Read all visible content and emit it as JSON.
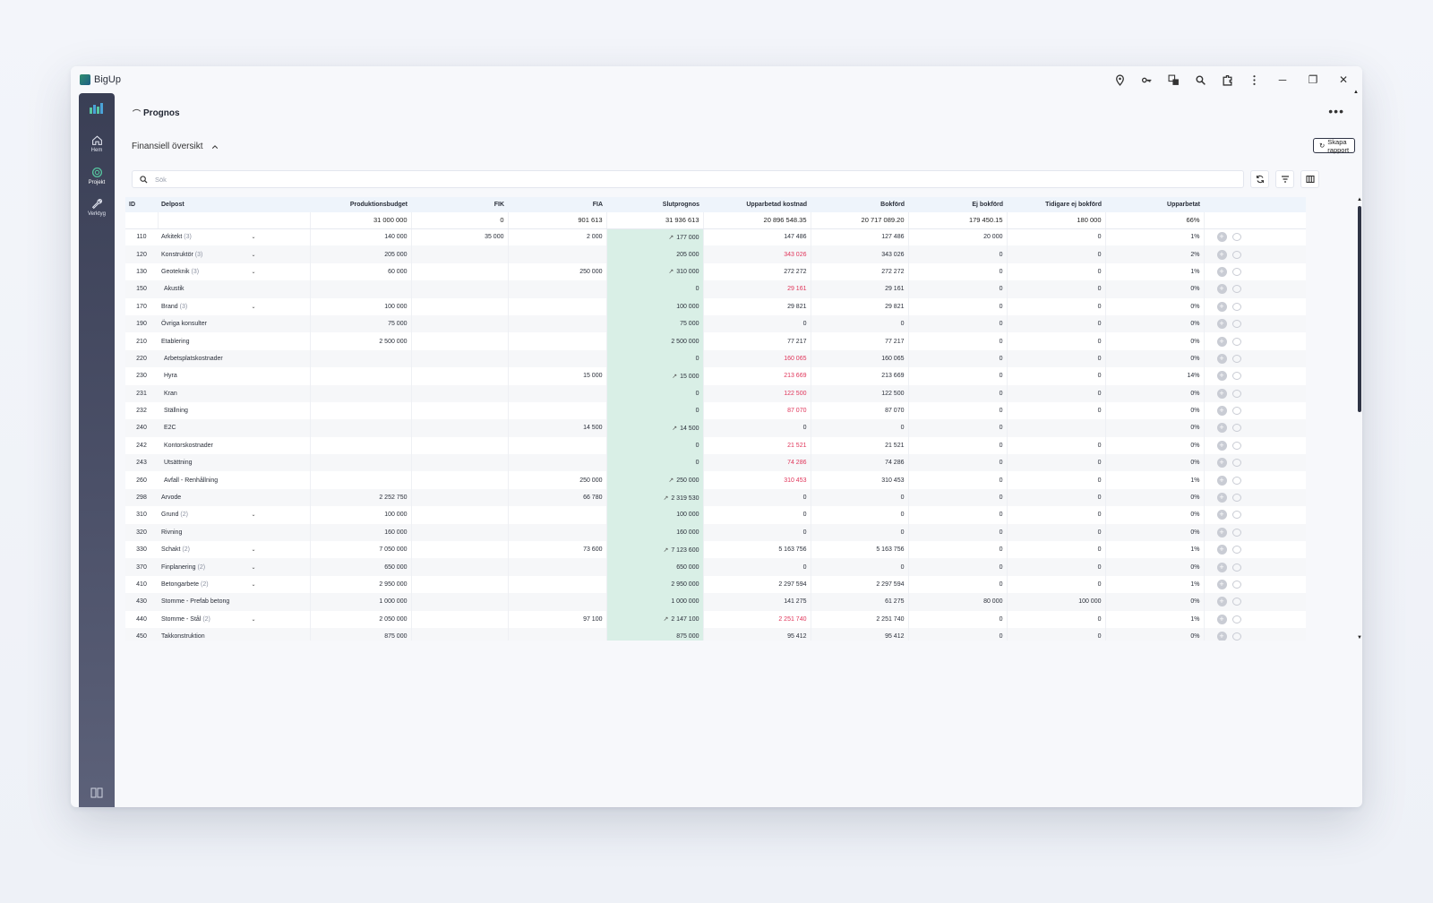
{
  "app": {
    "title": "BigUp"
  },
  "titlebar_icons": [
    "location-pin-icon",
    "key-icon",
    "translate-icon",
    "zoom-icon",
    "extension-icon",
    "kebab-menu-icon"
  ],
  "window_controls": {
    "minimize": "─",
    "restore": "❐",
    "close": "✕"
  },
  "sidebar": {
    "items": [
      {
        "label": "Hem",
        "icon": "home-icon"
      },
      {
        "label": "Projekt",
        "icon": "project-icon",
        "active": true
      },
      {
        "label": "Verktyg",
        "icon": "wrench-icon"
      }
    ]
  },
  "header": {
    "breadcrumb": "Prognos",
    "more": "•••"
  },
  "section": {
    "title": "Finansiell översikt",
    "report_button": "Skapa rapport"
  },
  "search": {
    "placeholder": "Sök"
  },
  "table": {
    "columns": [
      "ID",
      "Delpost",
      "Produktionsbudget",
      "FIK",
      "FIA",
      "Slutprognos",
      "Upparbetad kostnad",
      "Bokförd",
      "Ej bokförd",
      "Tidigare ej bokförd",
      "Upparbetat"
    ],
    "summary": [
      "",
      "",
      "31 000 000",
      "0",
      "901 613",
      "31 936 613",
      "20 896 548.35",
      "20 717 089.20",
      "179 450.15",
      "180 000",
      "66%"
    ],
    "rows": [
      {
        "id": "110",
        "name": "Arkitekt",
        "sub": "(3)",
        "exp": true,
        "pb": "140 000",
        "fik": "35 000",
        "fia": "2 000",
        "slut": "177 000",
        "trend": true,
        "upp": "147 486",
        "neg": false,
        "bok": "127 486",
        "ej": "20 000",
        "tid": "0",
        "pct": "1%"
      },
      {
        "id": "120",
        "name": "Konstruktör",
        "sub": "(3)",
        "exp": true,
        "pb": "205 000",
        "fik": "",
        "fia": "",
        "slut": "205 000",
        "trend": false,
        "upp": "343 026",
        "neg": true,
        "bok": "343 026",
        "ej": "0",
        "tid": "0",
        "pct": "2%"
      },
      {
        "id": "130",
        "name": "Geoteknik",
        "sub": "(3)",
        "exp": true,
        "pb": "60 000",
        "fik": "",
        "fia": "250 000",
        "slut": "310 000",
        "trend": true,
        "upp": "272 272",
        "neg": false,
        "bok": "272 272",
        "ej": "0",
        "tid": "0",
        "pct": "1%"
      },
      {
        "id": "150",
        "name": "Akustik",
        "sub": "",
        "exp": false,
        "ind": true,
        "pb": "",
        "fik": "",
        "fia": "",
        "slut": "0",
        "trend": false,
        "upp": "29 161",
        "neg": true,
        "bok": "29 161",
        "ej": "0",
        "tid": "0",
        "pct": "0%"
      },
      {
        "id": "170",
        "name": "Brand",
        "sub": "(3)",
        "exp": true,
        "pb": "100 000",
        "fik": "",
        "fia": "",
        "slut": "100 000",
        "trend": false,
        "upp": "29 821",
        "neg": false,
        "bok": "29 821",
        "ej": "0",
        "tid": "0",
        "pct": "0%"
      },
      {
        "id": "190",
        "name": "Övriga konsulter",
        "sub": "",
        "exp": false,
        "pb": "75 000",
        "fik": "",
        "fia": "",
        "slut": "75 000",
        "trend": false,
        "upp": "0",
        "neg": false,
        "bok": "0",
        "ej": "0",
        "tid": "0",
        "pct": "0%"
      },
      {
        "id": "210",
        "name": "Etablering",
        "sub": "",
        "exp": false,
        "pb": "2 500 000",
        "fik": "",
        "fia": "",
        "slut": "2 500 000",
        "trend": false,
        "upp": "77 217",
        "neg": false,
        "bok": "77 217",
        "ej": "0",
        "tid": "0",
        "pct": "0%"
      },
      {
        "id": "220",
        "name": "Arbetsplatskostnader",
        "sub": "",
        "exp": false,
        "ind": true,
        "pb": "",
        "fik": "",
        "fia": "",
        "slut": "0",
        "trend": false,
        "upp": "160 065",
        "neg": true,
        "bok": "160 065",
        "ej": "0",
        "tid": "0",
        "pct": "0%"
      },
      {
        "id": "230",
        "name": "Hyra",
        "sub": "",
        "exp": false,
        "ind": true,
        "pb": "",
        "fik": "",
        "fia": "15 000",
        "slut": "15 000",
        "trend": true,
        "upp": "213 669",
        "neg": true,
        "bok": "213 669",
        "ej": "0",
        "tid": "0",
        "pct": "14%"
      },
      {
        "id": "231",
        "name": "Kran",
        "sub": "",
        "exp": false,
        "ind": true,
        "pb": "",
        "fik": "",
        "fia": "",
        "slut": "0",
        "trend": false,
        "upp": "122 500",
        "neg": true,
        "bok": "122 500",
        "ej": "0",
        "tid": "0",
        "pct": "0%"
      },
      {
        "id": "232",
        "name": "Ställning",
        "sub": "",
        "exp": false,
        "ind": true,
        "pb": "",
        "fik": "",
        "fia": "",
        "slut": "0",
        "trend": false,
        "upp": "87 070",
        "neg": true,
        "bok": "87 070",
        "ej": "0",
        "tid": "0",
        "pct": "0%"
      },
      {
        "id": "240",
        "name": "E2C",
        "sub": "",
        "exp": false,
        "ind": true,
        "pb": "",
        "fik": "",
        "fia": "14 500",
        "slut": "14 500",
        "trend": true,
        "upp": "0",
        "neg": false,
        "bok": "0",
        "ej": "0",
        "tid": "",
        "pct": "0%"
      },
      {
        "id": "242",
        "name": "Kontorskostnader",
        "sub": "",
        "exp": false,
        "ind": true,
        "pb": "",
        "fik": "",
        "fia": "",
        "slut": "0",
        "trend": false,
        "upp": "21 521",
        "neg": true,
        "bok": "21 521",
        "ej": "0",
        "tid": "0",
        "pct": "0%"
      },
      {
        "id": "243",
        "name": "Utsättning",
        "sub": "",
        "exp": false,
        "ind": true,
        "pb": "",
        "fik": "",
        "fia": "",
        "slut": "0",
        "trend": false,
        "upp": "74 286",
        "neg": true,
        "bok": "74 286",
        "ej": "0",
        "tid": "0",
        "pct": "0%"
      },
      {
        "id": "260",
        "name": "Avfall - Renhållning",
        "sub": "",
        "exp": false,
        "ind": true,
        "pb": "",
        "fik": "",
        "fia": "250 000",
        "slut": "250 000",
        "trend": true,
        "upp": "310 453",
        "neg": true,
        "bok": "310 453",
        "ej": "0",
        "tid": "0",
        "pct": "1%"
      },
      {
        "id": "298",
        "name": "Arvode",
        "sub": "",
        "exp": false,
        "pb": "2 252 750",
        "fik": "",
        "fia": "66 780",
        "slut": "2 319 530",
        "trend": true,
        "upp": "0",
        "neg": false,
        "bok": "0",
        "ej": "0",
        "tid": "0",
        "pct": "0%"
      },
      {
        "id": "310",
        "name": "Grund",
        "sub": "(2)",
        "exp": true,
        "pb": "100 000",
        "fik": "",
        "fia": "",
        "slut": "100 000",
        "trend": false,
        "upp": "0",
        "neg": false,
        "bok": "0",
        "ej": "0",
        "tid": "0",
        "pct": "0%"
      },
      {
        "id": "320",
        "name": "Rivning",
        "sub": "",
        "exp": false,
        "pb": "160 000",
        "fik": "",
        "fia": "",
        "slut": "160 000",
        "trend": false,
        "upp": "0",
        "neg": false,
        "bok": "0",
        "ej": "0",
        "tid": "0",
        "pct": "0%"
      },
      {
        "id": "330",
        "name": "Schakt",
        "sub": "(2)",
        "exp": true,
        "pb": "7 050 000",
        "fik": "",
        "fia": "73 600",
        "slut": "7 123 600",
        "trend": true,
        "upp": "5 163 756",
        "neg": false,
        "bok": "5 163 756",
        "ej": "0",
        "tid": "0",
        "pct": "1%"
      },
      {
        "id": "370",
        "name": "Finplanering",
        "sub": "(2)",
        "exp": true,
        "pb": "650 000",
        "fik": "",
        "fia": "",
        "slut": "650 000",
        "trend": false,
        "upp": "0",
        "neg": false,
        "bok": "0",
        "ej": "0",
        "tid": "0",
        "pct": "0%"
      },
      {
        "id": "410",
        "name": "Betongarbete",
        "sub": "(2)",
        "exp": true,
        "pb": "2 950 000",
        "fik": "",
        "fia": "",
        "slut": "2 950 000",
        "trend": false,
        "upp": "2 297 594",
        "neg": false,
        "bok": "2 297 594",
        "ej": "0",
        "tid": "0",
        "pct": "1%"
      },
      {
        "id": "430",
        "name": "Stomme - Prefab betong",
        "sub": "",
        "exp": false,
        "pb": "1 000 000",
        "fik": "",
        "fia": "",
        "slut": "1 000 000",
        "trend": false,
        "upp": "141 275",
        "neg": false,
        "bok": "61 275",
        "ej": "80 000",
        "tid": "100 000",
        "pct": "0%"
      },
      {
        "id": "440",
        "name": "Stomme - Stål",
        "sub": "(2)",
        "exp": true,
        "pb": "2 050 000",
        "fik": "",
        "fia": "97 100",
        "slut": "2 147 100",
        "trend": true,
        "upp": "2 251 740",
        "neg": true,
        "bok": "2 251 740",
        "ej": "0",
        "tid": "0",
        "pct": "1%"
      },
      {
        "id": "450",
        "name": "Takkonstruktion",
        "sub": "",
        "exp": false,
        "pb": "875 000",
        "fik": "",
        "fia": "",
        "slut": "875 000",
        "trend": false,
        "upp": "95 412",
        "neg": false,
        "bok": "95 412",
        "ej": "0",
        "tid": "0",
        "pct": "0%"
      }
    ]
  },
  "colors": {
    "accent_green": "#d9efe6",
    "negative": "#e0355a",
    "sidebar": "#3a3f55"
  }
}
